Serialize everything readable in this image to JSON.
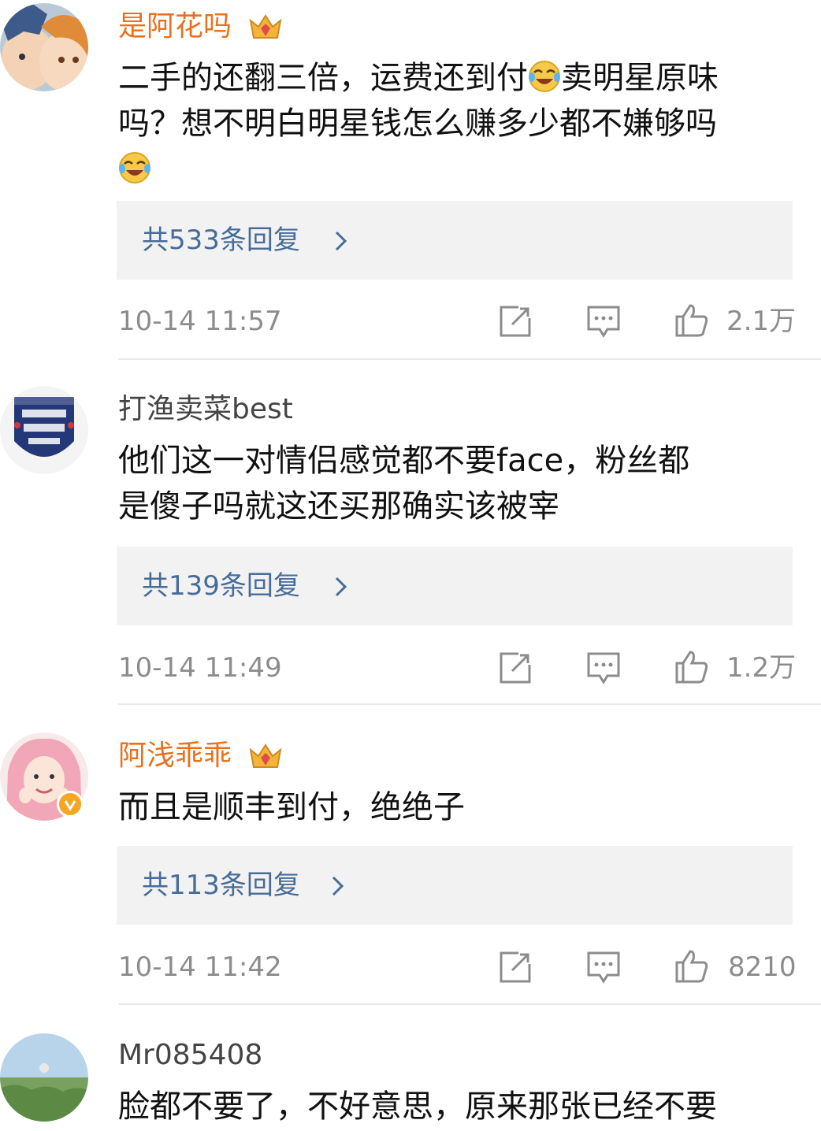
{
  "comments": [
    {
      "username": "是阿花吗",
      "name_color": "#e8711d",
      "badge_icon": "crown-level-icon",
      "text_lines": [
        "二手的还翻三倍，运费还到付",
        "卖明星原味",
        "吗？想不明白明星钱怎么赚多少都不嫌够吗"
      ],
      "emoji_icon": "laughing-crying-emoji-icon",
      "reply_label": "共533条回复",
      "timestamp": "10-14 11:57",
      "likes": "2.1万"
    },
    {
      "username": "打渔卖菜best",
      "name_color": "#444444",
      "text_lines": [
        "他们这一对情侣感觉都不要face，粉丝都",
        "是傻子吗就这还买那确实该被宰"
      ],
      "reply_label": "共139条回复",
      "timestamp": "10-14 11:49",
      "likes": "1.2万"
    },
    {
      "username": "阿浅乖乖",
      "name_color": "#e8711d",
      "badge_icon": "crown-level-icon",
      "verified_icon": "verified-badge-icon",
      "text_lines": [
        "而且是顺丰到付，绝绝子"
      ],
      "reply_label": "共113条回复",
      "timestamp": "10-14 11:42",
      "likes": "8210"
    },
    {
      "username": "Mr085408",
      "name_color": "#444444",
      "text_lines": [
        "脸都不要了，不好意思，原来那张已经不要"
      ]
    }
  ],
  "icons": {
    "share": "share-icon",
    "comment": "comment-icon",
    "like": "thumbs-up-icon",
    "chevron": "chevron-right-icon"
  },
  "colors": {
    "gold_name": "#e8711d",
    "reply_link": "#476c99",
    "meta_gray": "#8c8c8c",
    "reply_bg": "#f2f2f2"
  }
}
